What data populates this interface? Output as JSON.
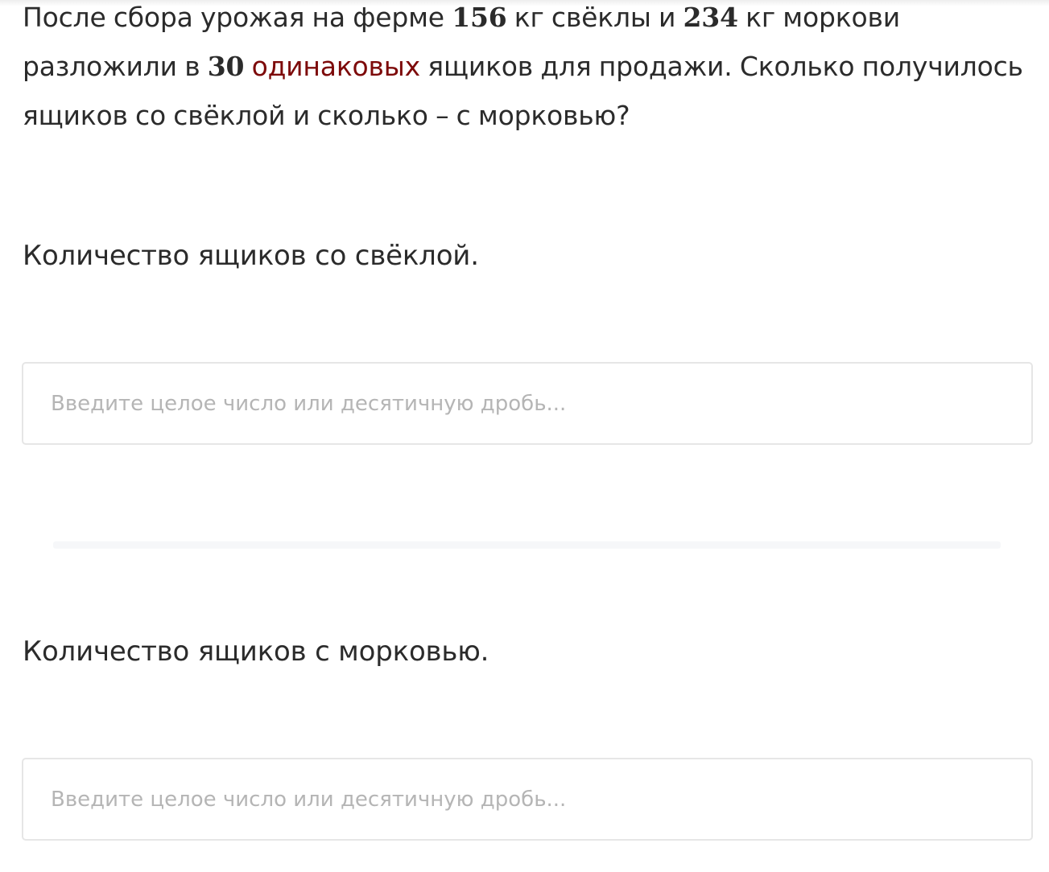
{
  "problem": {
    "part1": "После сбора урожая на ферме ",
    "beet_kg": "156",
    "part2": " кг свёклы и ",
    "carrot_kg": "234",
    "part3": " кг моркови разложили в ",
    "boxes": "30",
    "part4": " ",
    "term": "одинаковых",
    "part5": " ящиков для продажи. Сколько получилось ящиков со свёклой и сколько – с морковью?"
  },
  "questions": [
    {
      "label": "Количество ящиков со свёклой.",
      "value": "",
      "placeholder": "Введите целое число или десятичную дробь..."
    },
    {
      "label": "Количество ящиков с морковью.",
      "value": "",
      "placeholder": "Введите целое число или десятичную дробь..."
    }
  ],
  "colors": {
    "text": "#2b2b2b",
    "term_link": "#7d0a0a",
    "input_border": "#e6e6e6",
    "placeholder": "#b5b5b5"
  }
}
